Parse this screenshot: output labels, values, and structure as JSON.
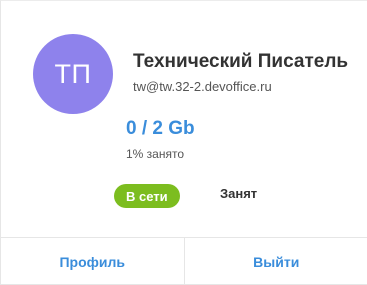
{
  "profile": {
    "initials": "ТП",
    "name": "Технический Писатель",
    "email": "tw@tw.32-2.devoffice.ru",
    "avatar_color": "#8e82ec"
  },
  "quota": {
    "value": "0 / 2 Gb",
    "used": "1% занято",
    "used_fraction": 0.01
  },
  "status": {
    "online_label": "В сети",
    "busy_label": "Занят",
    "active": "online",
    "online_color": "#7cbd1f"
  },
  "footer": {
    "profile_label": "Профиль",
    "logout_label": "Выйти",
    "link_color": "#3a8ddb"
  }
}
